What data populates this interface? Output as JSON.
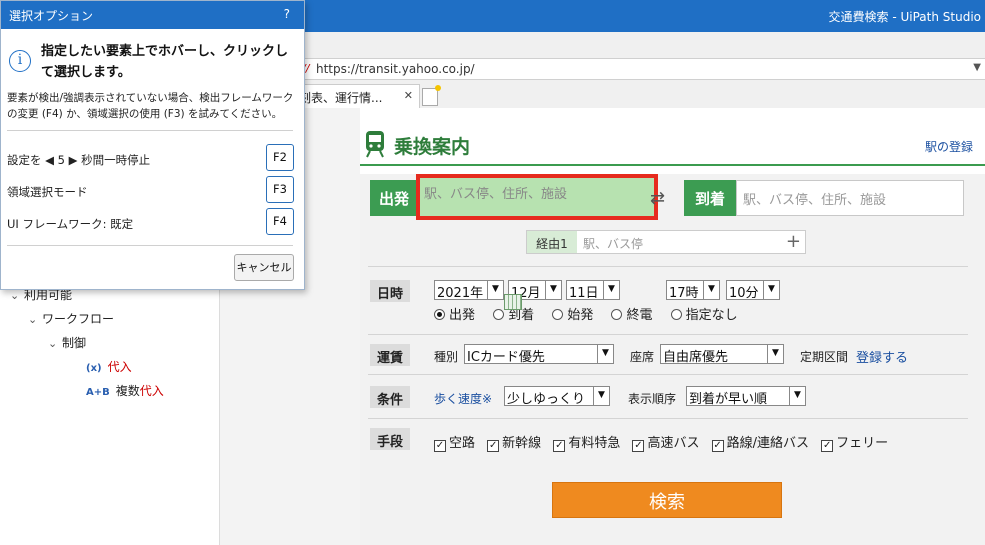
{
  "studio": {
    "window_title": "交通費検索 - UiPath Studio",
    "tree": {
      "available": "利用可能",
      "workflow": "ワークフロー",
      "control": "制御",
      "assign_prefix": "(x)",
      "assign": "代入",
      "multi_assign_prefix": "A+B",
      "multi_assign_a": "複数",
      "multi_assign_b": "代入"
    }
  },
  "browser": {
    "url": "https://transit.yahoo.co.jp/",
    "tab_label": "時刻表、運行情...",
    "tab_close": "✕"
  },
  "transit": {
    "title": "乗換案内",
    "station_register": "駅の登録",
    "depart_label": "出発",
    "depart_placeholder": "駅、バス停、住所、施設",
    "arrive_label": "到着",
    "arrive_placeholder": "駅、バス停、住所、施設",
    "via_label": "経由1",
    "via_placeholder": "駅、バス停",
    "date_label": "日時",
    "year": "2021年",
    "month": "12月",
    "day": "11日",
    "hour": "17時",
    "minute": "10分",
    "radios": [
      "出発",
      "到着",
      "始発",
      "終電",
      "指定なし"
    ],
    "fare_label": "運賃",
    "kind_label": "種別",
    "kind_value": "ICカード優先",
    "seat_label": "座席",
    "seat_value": "自由席優先",
    "commuter_label": "定期区間",
    "commuter_link": "登録する",
    "condition_label": "条件",
    "walk_speed": "歩く速度※",
    "walk_value": "少しゆっくり",
    "order_label": "表示順序",
    "order_value": "到着が早い順",
    "means_label": "手段",
    "means": [
      "空路",
      "新幹線",
      "有料特急",
      "高速バス",
      "路線/連絡バス",
      "フェリー"
    ],
    "search_button": "検索"
  },
  "dialog": {
    "title": "選択オプション",
    "help": "?",
    "heading": "指定したい要素上でホバーし、クリックして選択します。",
    "description": "要素が検出/強調表示されていない場合、検出フレームワークの変更 (F4) か、領域選択の使用 (F3) を試みてください。",
    "option1": "設定を ◀ 5 ▶ 秒間一時停止",
    "option1_key": "F2",
    "option2": "領域選択モード",
    "option2_key": "F3",
    "option3": "UI フレームワーク: 既定",
    "option3_key": "F4",
    "cancel": "キャンセル"
  },
  "colors": {
    "studio_blue": "#1f6fc5",
    "transit_green": "#3c9c52",
    "highlight_red": "#e62b1e",
    "search_orange": "#ef8a1f"
  }
}
